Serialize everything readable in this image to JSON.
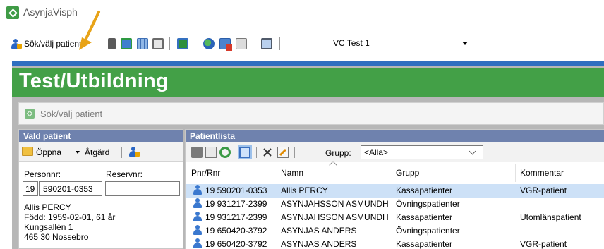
{
  "window": {
    "title": "AsynjaVisph"
  },
  "toolbar": {
    "search_patient_label": "Sök/välj patient",
    "unit_select_value": "VC Test 1",
    "icons": [
      "note-icon",
      "users-icon",
      "grid-icon",
      "clipboard-icon",
      "presentation-icon",
      "globe-icon",
      "add-window-icon",
      "message-icon",
      "monitor-icon"
    ]
  },
  "banner": {
    "title": "Test/Utbildning"
  },
  "subheader": {
    "label": "Sök/välj patient"
  },
  "left_panel": {
    "header": "Vald patient",
    "open_label": "Öppna",
    "action_label": "Åtgärd",
    "personnr_label": "Personnr:",
    "reservnr_label": "Reservnr:",
    "personnr_year": "19",
    "personnr_value": "590201-0353",
    "reservnr_value": "",
    "patient_name": "Allis PERCY",
    "patient_born": "Född: 1959-02-01, 61 år",
    "patient_street": "Kungsallén 1",
    "patient_city": "465 30 Nossebro"
  },
  "right_panel": {
    "header": "Patientlista",
    "group_label": "Grupp:",
    "group_value": "<Alla>",
    "columns": [
      "Pnr/Rnr",
      "Namn",
      "Grupp",
      "Kommentar"
    ],
    "rows": [
      {
        "pnr": "19  590201-0353",
        "name": "Allis PERCY",
        "group": "Kassapatienter",
        "comment": "VGR-patient",
        "selected": true
      },
      {
        "pnr": "19  931217-2399",
        "name": "ASYNJAHSSON ASMUNDH",
        "group": "Övningspatienter",
        "comment": "",
        "selected": false
      },
      {
        "pnr": "19  931217-2399",
        "name": "ASYNJAHSSON ASMUNDH",
        "group": "Kassapatienter",
        "comment": "Utomlänspatient",
        "selected": false
      },
      {
        "pnr": "19  650420-3792",
        "name": "ASYNJAS ANDERS",
        "group": "Övningspatienter",
        "comment": "",
        "selected": false
      },
      {
        "pnr": "19  650420-3792",
        "name": "ASYNJAS ANDERS",
        "group": "Kassapatienter",
        "comment": "VGR-patient",
        "selected": false
      }
    ]
  },
  "colors": {
    "banner": "#43a047",
    "panel_header": "#6f82ae",
    "selected_row": "#cde1f7",
    "accent_arrow": "#e8a317"
  }
}
